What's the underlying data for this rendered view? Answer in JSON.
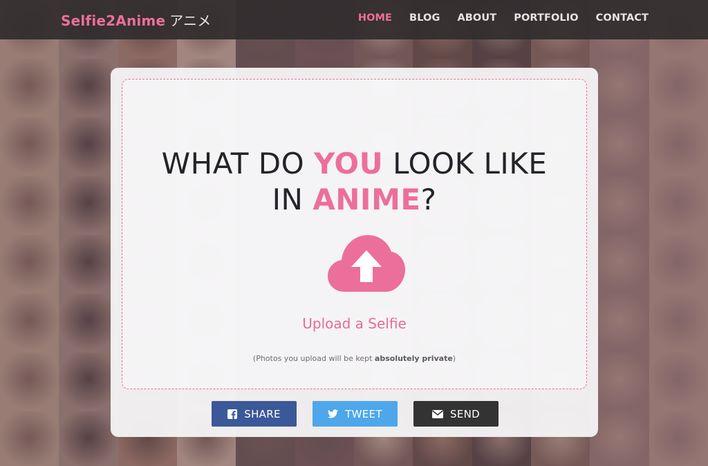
{
  "colors": {
    "accent": "#ec6f9b",
    "navbar_bg": "#322d2e",
    "share": "#3b5998",
    "tweet": "#4da7ea",
    "send": "#333333"
  },
  "navbar": {
    "brand": "Selfie2Anime",
    "brand_kana": "アニメ",
    "links": [
      "HOME",
      "BLOG",
      "ABOUT",
      "PORTFOLIO",
      "CONTACT"
    ],
    "active_link": "HOME"
  },
  "hero": {
    "line1_a": "WHAT DO ",
    "line1_b": "YOU",
    "line1_c": " LOOK LIKE",
    "line2_a": "IN ",
    "line2_b": "ANIME",
    "line2_c": "?"
  },
  "upload": {
    "icon": "cloud-upload-icon",
    "label": "Upload a Selfie",
    "privacy_prefix": "(Photos you upload will be kept ",
    "privacy_bold": "absolutely private",
    "privacy_suffix": ")"
  },
  "share_buttons": [
    {
      "label": "SHARE",
      "icon": "facebook-icon"
    },
    {
      "label": "TWEET",
      "icon": "twitter-icon"
    },
    {
      "label": "SEND",
      "icon": "envelope-icon"
    }
  ]
}
